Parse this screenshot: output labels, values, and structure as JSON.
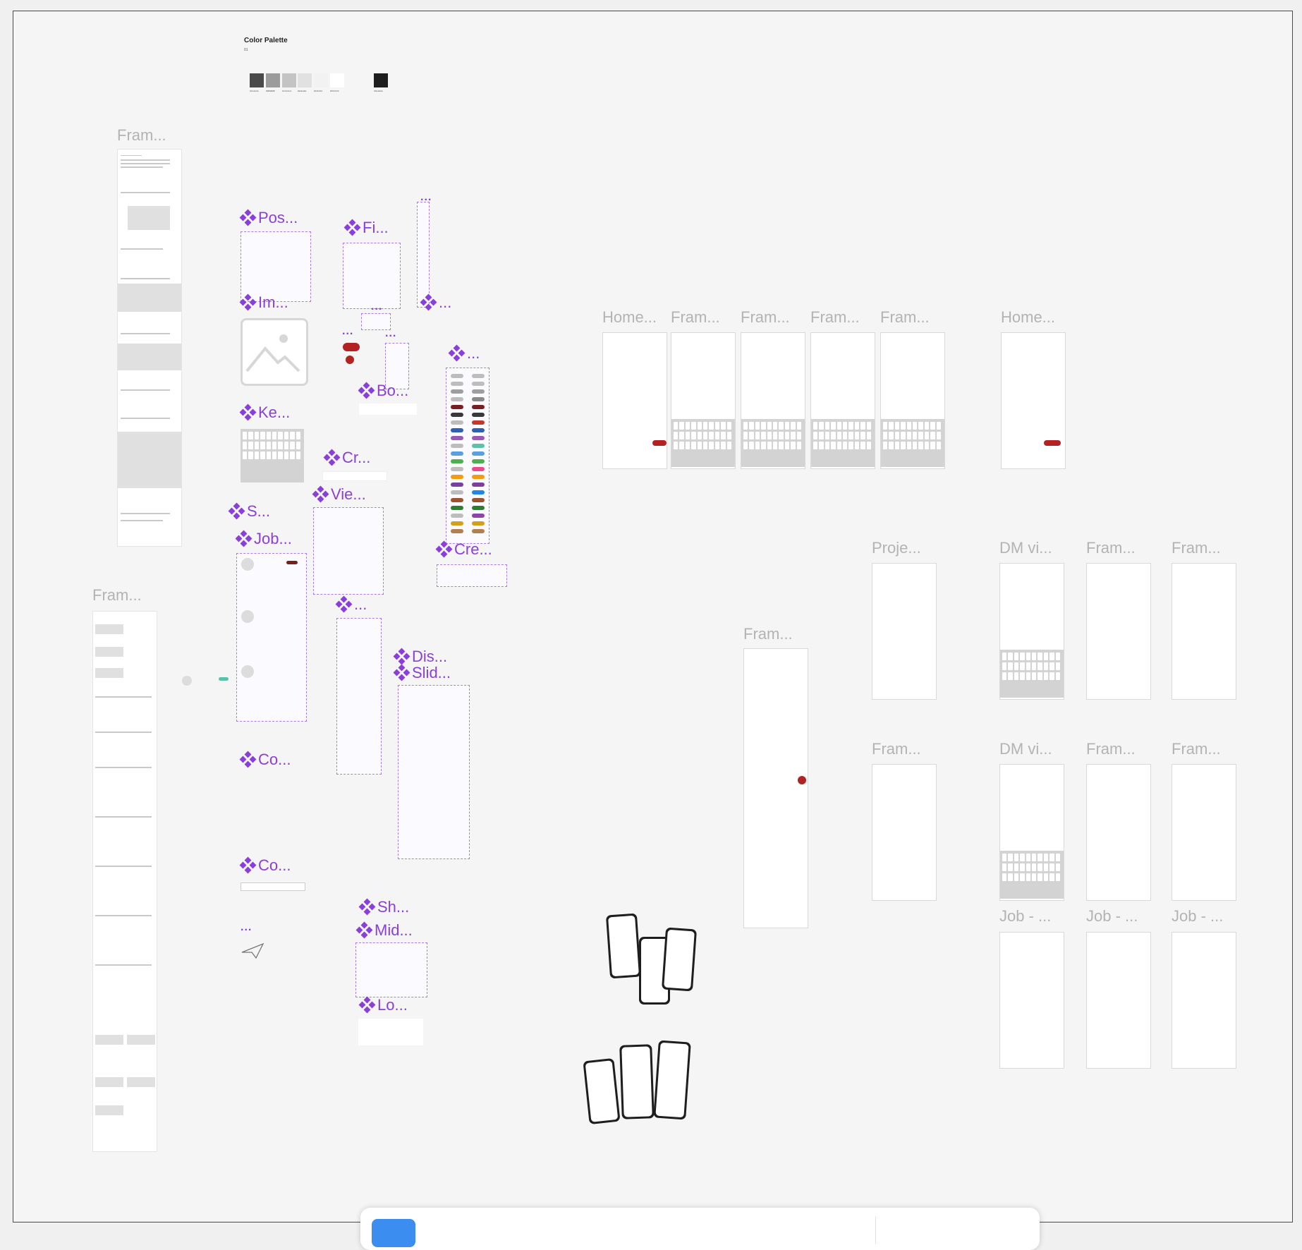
{
  "palette": {
    "title": "Color Palette",
    "subtitle": "01",
    "swatches": [
      {
        "color": "#4a4a4a",
        "label": "#4A4A4A"
      },
      {
        "color": "#9b9b9b",
        "label": "#9B9B9B"
      },
      {
        "color": "#c4c4c4",
        "label": "#C4C4C4"
      },
      {
        "color": "#e1e1e1",
        "label": "#E1E1E1"
      },
      {
        "color": "#f2f2f2",
        "label": "#F2F2F2"
      },
      {
        "color": "#ffffff",
        "label": "#FFFFFF"
      },
      {
        "color": "#1e1e1e",
        "label": "#1E1E1E"
      }
    ]
  },
  "frame_labels": {
    "frame_left_top": "Fram...",
    "frame_left_bottom": "Fram...",
    "home1": "Home...",
    "fram1": "Fram...",
    "fram2": "Fram...",
    "fram3": "Fram...",
    "fram4": "Fram...",
    "home2": "Home...",
    "proje": "Proje...",
    "dm1": "DM vi...",
    "fram5": "Fram...",
    "fram6": "Fram...",
    "fram_mid": "Fram...",
    "fram7": "Fram...",
    "dm2": "DM vi...",
    "fram8": "Fram...",
    "fram9": "Fram...",
    "job1": "Job - ...",
    "job2": "Job - ...",
    "job3": "Job - ..."
  },
  "component_labels": {
    "pos": "Pos...",
    "fi": "Fi...",
    "im": "Im...",
    "bo": "Bo...",
    "ke": "Ke...",
    "cr": "Cr...",
    "vie": "Vie...",
    "s": "S...",
    "job": "Job...",
    "cre": "Cre...",
    "dis": "Dis...",
    "slid": "Slid...",
    "co1": "Co...",
    "co2": "Co...",
    "sh": "Sh...",
    "mid": "Mid...",
    "lo": "Lo..."
  },
  "overflow_marker": "...",
  "colors": {
    "canvas": "#f5f5f5",
    "component": "#8b3fd9",
    "frame_label": "#b3b3b3",
    "brand": "#7a1f1f",
    "toolbar_active": "#3b8ef0"
  },
  "toolbar": {
    "tools": [
      "move-tool",
      "frame-tool",
      "shape-tool",
      "pen-tool",
      "text-tool",
      "comment-tool",
      "actions-tool"
    ]
  }
}
